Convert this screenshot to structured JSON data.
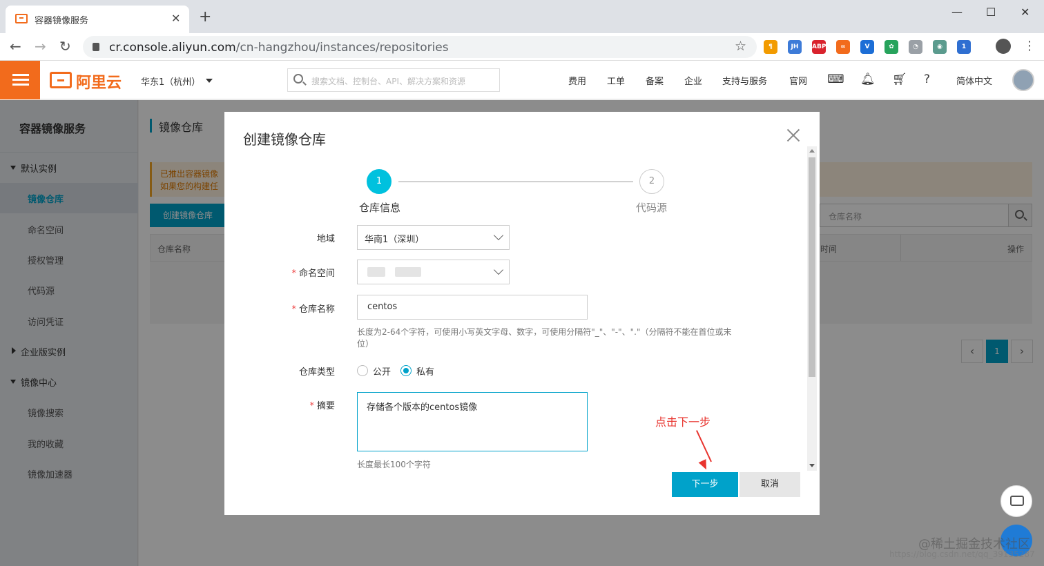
{
  "browser": {
    "tab_title": "容器镜像服务",
    "url_domain": "cr.console.aliyun.com",
    "url_path": "/cn-hangzhou/instances/repositories",
    "minimize": "—",
    "maximize": "☐",
    "close": "✕",
    "extensions": [
      {
        "name": "paragraph-ext-icon",
        "label": "¶",
        "color": "#f29b00"
      },
      {
        "name": "jh-ext-icon",
        "label": "JH",
        "color": "#3d7bd8"
      },
      {
        "name": "abp-ext-icon",
        "label": "ABP",
        "color": "#d9232d"
      },
      {
        "name": "infinity-ext-icon",
        "label": "∞",
        "color": "#f26b1c"
      },
      {
        "name": "v-ext-icon",
        "label": "V",
        "color": "#1c6ed6"
      },
      {
        "name": "green-ext-icon",
        "label": "✿",
        "color": "#27a35c"
      },
      {
        "name": "gray-ext-icon",
        "label": "◔",
        "color": "#9aa0a6"
      },
      {
        "name": "owl-ext-icon",
        "label": "◉",
        "color": "#5b9b8e"
      },
      {
        "name": "badge-ext-icon",
        "label": "1",
        "color": "#2f6fd1"
      }
    ]
  },
  "header": {
    "logo_text": "阿里云",
    "region": "华东1（杭州）",
    "search_placeholder": "搜索文档、控制台、API、解决方案和资源",
    "nav": [
      "费用",
      "工单",
      "备案",
      "企业",
      "支持与服务",
      "官网"
    ],
    "language": "简体中文"
  },
  "sidebar": {
    "title": "容器镜像服务",
    "items": [
      {
        "label": "默认实例",
        "type": "group-open"
      },
      {
        "label": "镜像仓库",
        "type": "active"
      },
      {
        "label": "命名空间",
        "type": "item"
      },
      {
        "label": "授权管理",
        "type": "item"
      },
      {
        "label": "代码源",
        "type": "item"
      },
      {
        "label": "访问凭证",
        "type": "item"
      },
      {
        "label": "企业版实例",
        "type": "group-closed"
      },
      {
        "label": "镜像中心",
        "type": "group-open"
      },
      {
        "label": "镜像搜索",
        "type": "item"
      },
      {
        "label": "我的收藏",
        "type": "item"
      },
      {
        "label": "镜像加速器",
        "type": "item"
      }
    ]
  },
  "main": {
    "title": "镜像仓库",
    "notice_line1": "已推出容器镜像",
    "notice_line2": "如果您的构建任",
    "create_button": "创建镜像仓库",
    "search_placeholder": "仓库名称",
    "col_name": "仓库名称",
    "col_time": "时间",
    "col_ops": "操作",
    "page": "1"
  },
  "modal": {
    "title": "创建镜像仓库",
    "steps": [
      {
        "number": "1",
        "label": "仓库信息"
      },
      {
        "number": "2",
        "label": "代码源"
      }
    ],
    "region_label": "地域",
    "region_value": "华南1（深圳）",
    "namespace_label": "命名空间",
    "repo_name_label": "仓库名称",
    "repo_name_value": "centos",
    "repo_name_hint": "长度为2-64个字符，可使用小写英文字母、数字，可使用分隔符\"_\"、\"-\"、\".\"（分隔符不能在首位或末位）",
    "repo_type_label": "仓库类型",
    "repo_type_public": "公开",
    "repo_type_private": "私有",
    "summary_label": "摘要",
    "summary_value": "存储各个版本的centos镜像",
    "summary_hint": "长度最长100个字符",
    "annotation": "点击下一步",
    "next_button": "下一步",
    "cancel_button": "取消"
  },
  "watermark": {
    "line1": "@稀土掘金技术社区",
    "line2": "https://blog.csdn.net/qq_39135287"
  }
}
